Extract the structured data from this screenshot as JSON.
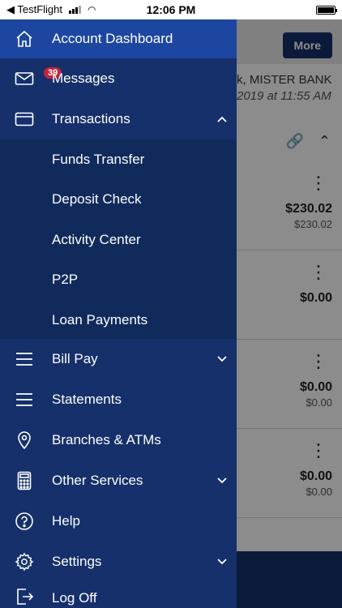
{
  "status_bar": {
    "back_app": "TestFlight",
    "time": "12:06 PM"
  },
  "background": {
    "more_button": "More",
    "account_name": "k, MISTER BANK",
    "as_of": "2019 at 11:55 AM",
    "rows": [
      {
        "amount": "$230.02",
        "sub": "$230.02"
      },
      {
        "amount": "$0.00",
        "sub": ""
      },
      {
        "amount": "$0.00",
        "sub": "$0.00"
      },
      {
        "amount": "$0.00",
        "sub": "$0.00"
      }
    ]
  },
  "drawer": {
    "items": [
      {
        "label": "Account Dashboard",
        "icon": "home-icon"
      },
      {
        "label": "Messages",
        "icon": "mail-icon",
        "badge": "39"
      },
      {
        "label": "Transactions",
        "icon": "card-icon"
      },
      {
        "label": "Bill Pay",
        "icon": "list-icon"
      },
      {
        "label": "Statements",
        "icon": "list-icon"
      },
      {
        "label": "Branches & ATMs",
        "icon": "location-pin-icon"
      },
      {
        "label": "Other Services",
        "icon": "calculator-icon"
      },
      {
        "label": "Help",
        "icon": "help-icon"
      },
      {
        "label": "Settings",
        "icon": "gear-icon"
      },
      {
        "label": "Log Off",
        "icon": "logout-icon"
      }
    ],
    "transactions_sub": [
      "Funds Transfer",
      "Deposit Check",
      "Activity Center",
      "P2P",
      "Loan Payments"
    ]
  },
  "colors": {
    "drawer_bg": "#15306a",
    "active_bg": "#1c46a0",
    "sub_bg": "#112a5c",
    "badge": "#c0263a"
  }
}
